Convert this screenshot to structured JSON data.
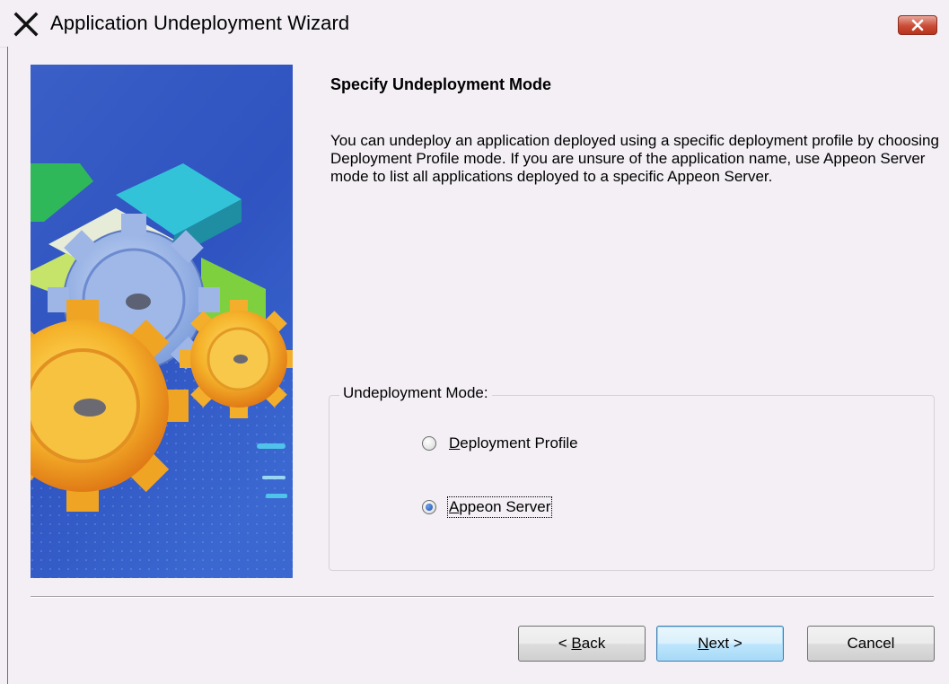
{
  "window": {
    "title": "Application Undeployment Wizard",
    "close_glyph": "✕"
  },
  "page": {
    "heading": "Specify Undeployment Mode",
    "description": "You can undeploy an application deployed using a specific deployment profile by choosing Deployment Profile mode. If you are unsure of the application name, use Appeon Server mode to list all applications deployed to a specific Appeon Server."
  },
  "mode_group": {
    "label": "Undeployment Mode:",
    "options": [
      {
        "access_key": "D",
        "label_rest": "eployment Profile",
        "checked": false
      },
      {
        "access_key": "A",
        "label_rest": "ppeon Server",
        "checked": true
      }
    ]
  },
  "buttons": {
    "back": {
      "prefix": "< ",
      "access_key": "B",
      "rest": "ack"
    },
    "next": {
      "access_key": "N",
      "rest": "ext >"
    },
    "cancel": "Cancel"
  },
  "icons": {
    "app": "appeon-x-icon",
    "close": "close-icon",
    "side_image": "gears-illustration"
  },
  "colors": {
    "window_bg": "#f3eff5",
    "close_red": "#c94c36",
    "image_blue": "#3b63c8"
  }
}
